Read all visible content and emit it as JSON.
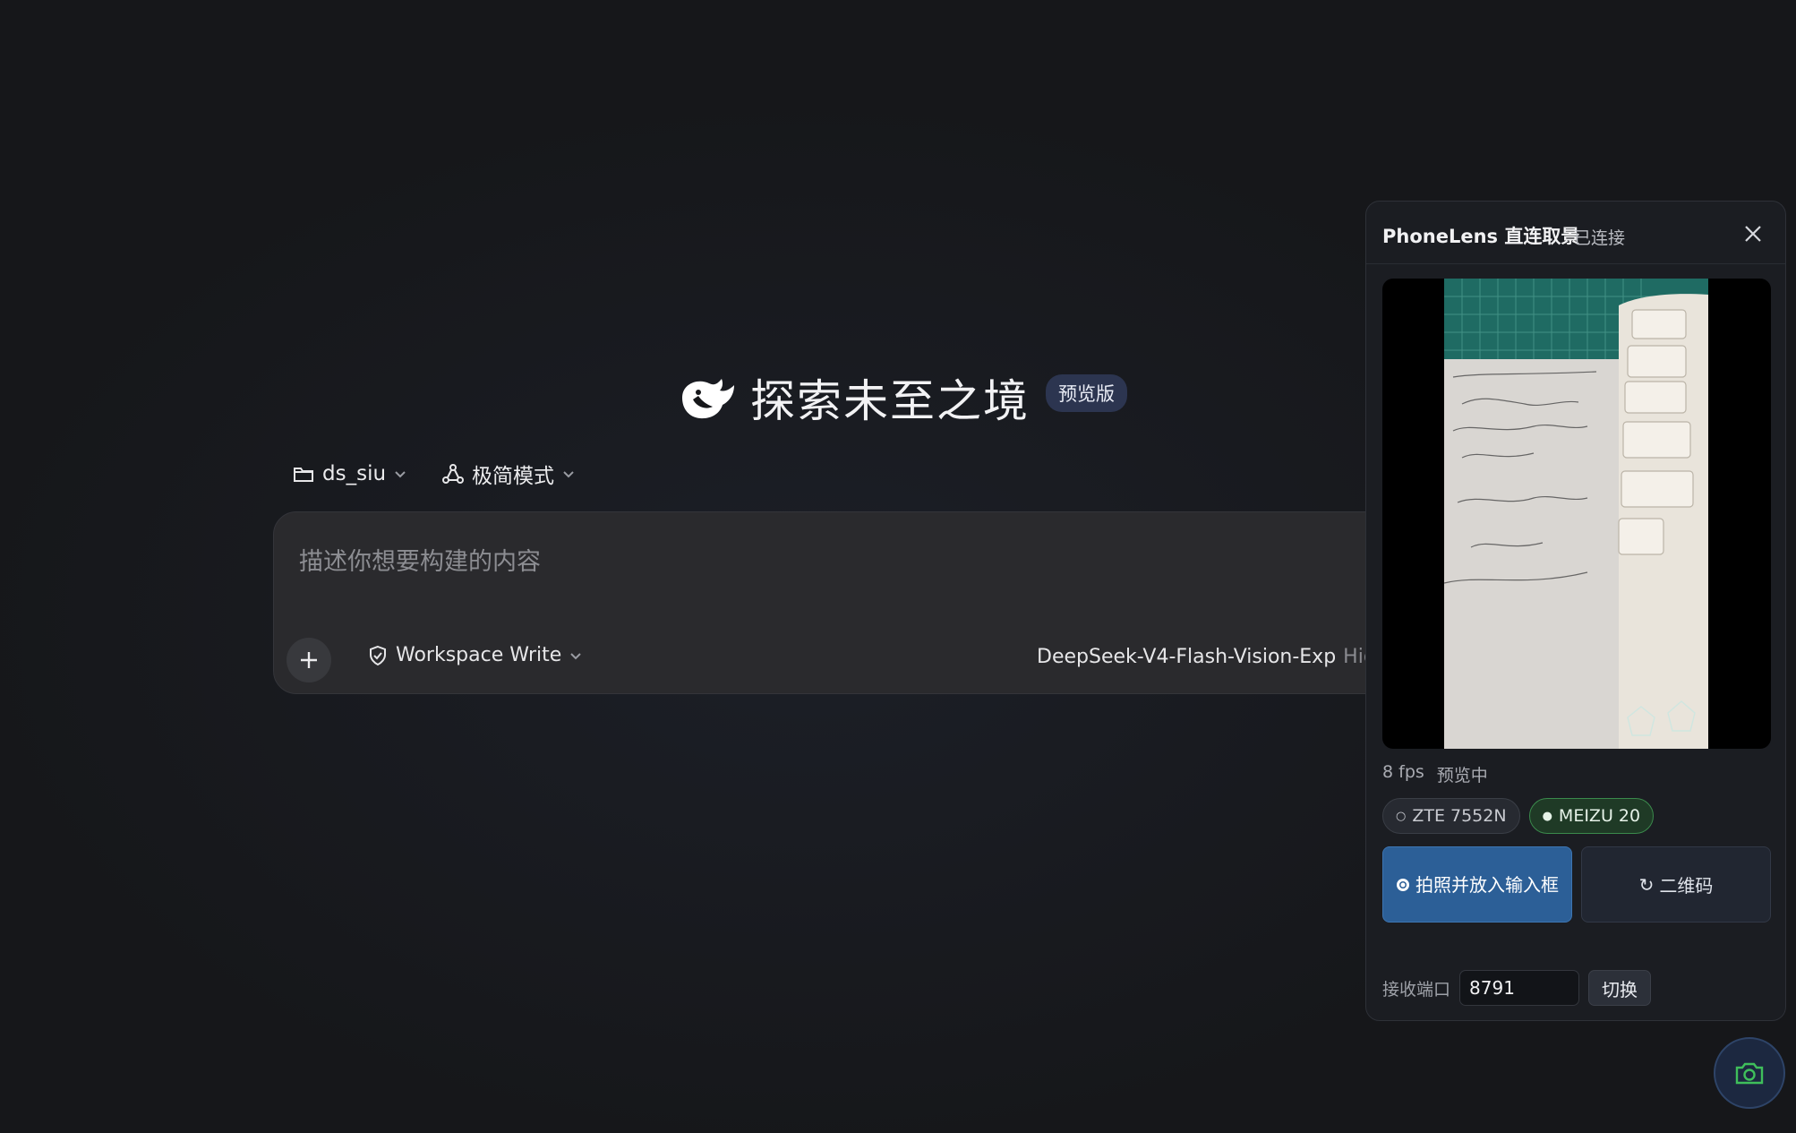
{
  "hero": {
    "title": "探索未至之境",
    "badge": "预览版"
  },
  "selectors": {
    "folder": "ds_siu",
    "mode": "极简模式"
  },
  "composer": {
    "placeholder": "描述你想要构建的内容",
    "permission": "Workspace Write",
    "model": "DeepSeek-V4-Flash-Vision-Exp",
    "effort": "High"
  },
  "panel": {
    "title": "PhoneLens 直连取景",
    "status": "已连接",
    "fps": "8 fps",
    "preview_status": "预览中",
    "devices": [
      {
        "label": "ZTE 7552N",
        "active": false,
        "marker": "○"
      },
      {
        "label": "MEIZU 20",
        "active": true,
        "marker": "●"
      }
    ],
    "capture_label": "拍照并放入输入框",
    "qr_label": "二维码",
    "port_label": "接收端口",
    "port_value": "8791",
    "switch_label": "切换"
  },
  "icons": {
    "logo": "deepseek-whale-icon",
    "folder": "folder-icon",
    "mode": "network-icon",
    "permission": "shield-check-icon",
    "add": "plus-icon",
    "close": "close-icon",
    "capture": "radio-dot-icon",
    "refresh": "refresh-icon",
    "camera": "camera-icon"
  },
  "colors": {
    "accent": "#2c5f97",
    "active_device": "#3b8a4c",
    "camera_fab": "#3fbf5b"
  }
}
